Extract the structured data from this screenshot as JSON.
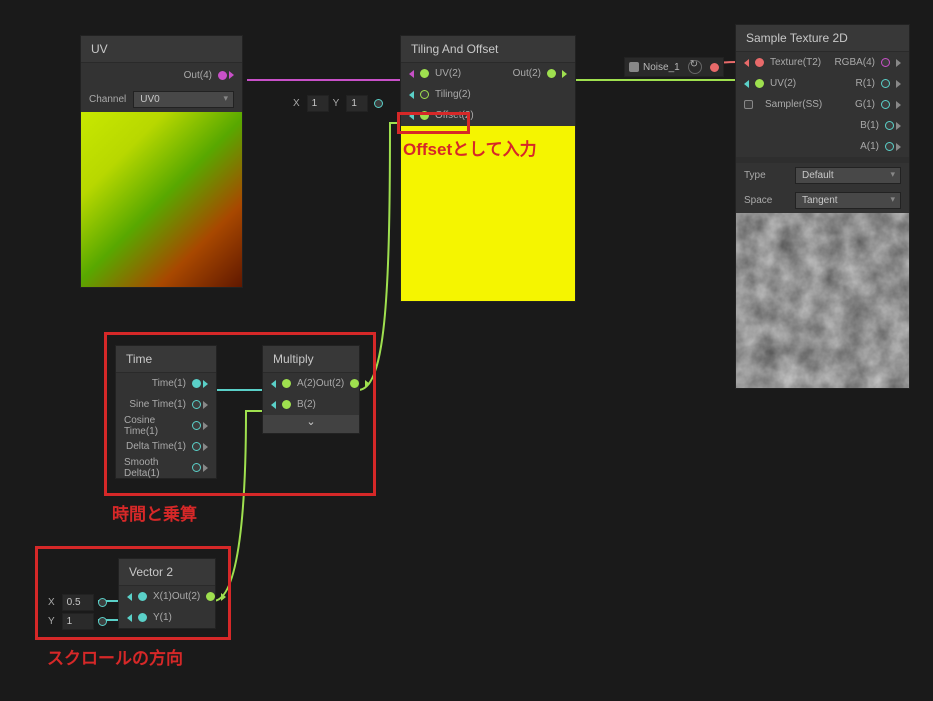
{
  "nodes": {
    "uv": {
      "title": "UV",
      "out_label": "Out(4)",
      "channel_label": "Channel",
      "channel_value": "UV0"
    },
    "tiling_offset": {
      "title": "Tiling And Offset",
      "ports": {
        "uv": "UV(2)",
        "tiling": "Tiling(2)",
        "offset": "Offset(2)",
        "out": "Out(2)"
      },
      "tiling_x": "1",
      "tiling_y": "1"
    },
    "sample_tex": {
      "title": "Sample Texture 2D",
      "noise_input": "Noise_1",
      "ports": {
        "texture": "Texture(T2)",
        "uv": "UV(2)",
        "sampler": "Sampler(SS)",
        "rgba": "RGBA(4)",
        "r": "R(1)",
        "g": "G(1)",
        "b": "B(1)",
        "a": "A(1)"
      },
      "type_label": "Type",
      "type_value": "Default",
      "space_label": "Space",
      "space_value": "Tangent"
    },
    "time": {
      "title": "Time",
      "ports": {
        "time": "Time(1)",
        "sine": "Sine Time(1)",
        "cosine": "Cosine Time(1)",
        "delta": "Delta Time(1)",
        "smooth": "Smooth Delta(1)"
      }
    },
    "multiply": {
      "title": "Multiply",
      "ports": {
        "a": "A(2)",
        "b": "B(2)",
        "out": "Out(2)"
      }
    },
    "vector2": {
      "title": "Vector 2",
      "x_label": "X",
      "y_label": "Y",
      "x_value": "0.5",
      "y_value": "1",
      "ports": {
        "x": "X(1)",
        "y": "Y(1)",
        "out": "Out(2)"
      }
    }
  },
  "annotations": {
    "offset_label": "Offsetとして入力",
    "time_multiply_label": "時間と乗算",
    "scroll_dir_label": "スクロールの方向"
  }
}
